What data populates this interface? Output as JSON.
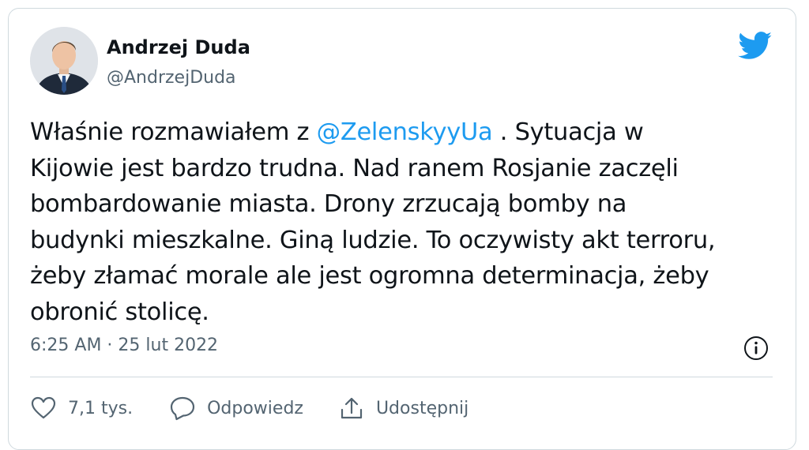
{
  "author": {
    "name": "Andrzej Duda",
    "handle": "@AndrzejDuda"
  },
  "tweet": {
    "lines": [
      [
        "Właśnie rozmawiałem z ",
        "@ZelenskyyUa",
        " . Sytuacja w"
      ],
      "Kijowie jest bardzo trudna. Nad ranem Rosjanie zaczęli",
      "bombardowanie miasta. Drony zrzucają bomby na",
      "budynki mieszkalne. Giną ludzie. To oczywisty akt terroru,",
      "żeby złamać morale ale jest ogromna determinacja, żeby",
      "obronić stolicę."
    ],
    "timestamp": "6:25 AM · 25 lut 2022"
  },
  "actions": {
    "like_count": "7,1 tys.",
    "reply_label": "Odpowiedz",
    "share_label": "Udostępnij"
  },
  "icons": {
    "logo": "twitter-bird-icon",
    "info": "info-icon",
    "like": "heart-icon",
    "reply": "speech-bubble-icon",
    "share": "share-upload-icon"
  },
  "colors": {
    "accent": "#1d9bf0",
    "text": "#0f1419",
    "secondary": "#536471",
    "border": "#cfd9de"
  }
}
